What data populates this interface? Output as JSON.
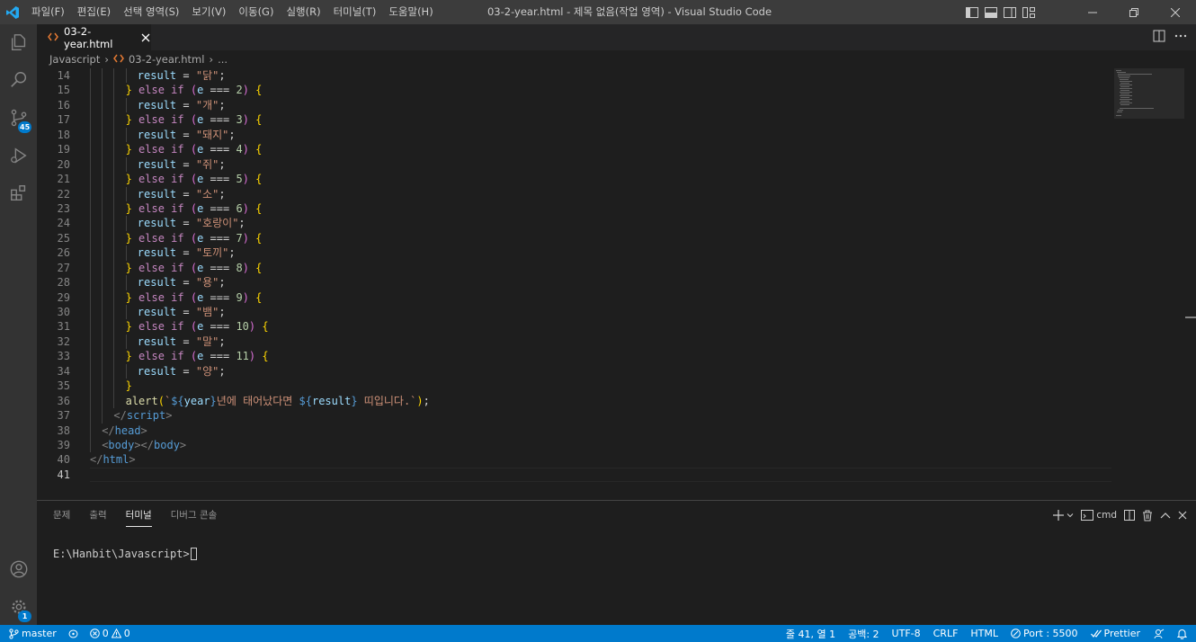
{
  "window": {
    "title": "03-2-year.html - 제목 없음(작업 영역) - Visual Studio Code",
    "menu": [
      "파일(F)",
      "편집(E)",
      "선택 영역(S)",
      "보기(V)",
      "이동(G)",
      "실행(R)",
      "터미널(T)",
      "도움말(H)"
    ]
  },
  "activity": {
    "scm_badge": "45",
    "settings_badge": "1"
  },
  "tab": {
    "label": "03-2-year.html"
  },
  "breadcrumb": {
    "folder": "Javascript",
    "file": "03-2-year.html",
    "more": "..."
  },
  "colors": {
    "accent": "#007acc",
    "keyword": "#c586c0",
    "string": "#ce9178",
    "variable": "#9cdcfe",
    "number": "#b5cea8",
    "tag": "#569cd6",
    "function": "#dcdcaa",
    "bracket_gold": "#ffd700",
    "bracket_purple": "#da70d6",
    "punct": "#808080"
  },
  "editor": {
    "current_line": 41,
    "lines": [
      {
        "n": "14",
        "indent": 4,
        "tokens": [
          {
            "t": "result",
            "c": "variable"
          },
          {
            "t": " = ",
            "c": "text"
          },
          {
            "t": "\"닭\"",
            "c": "string"
          },
          {
            "t": ";",
            "c": "text"
          }
        ]
      },
      {
        "n": "15",
        "indent": 3,
        "tokens": [
          {
            "t": "}",
            "c": "bracket_gold"
          },
          {
            "t": " else if ",
            "c": "keyword"
          },
          {
            "t": "(",
            "c": "bracket_purple"
          },
          {
            "t": "e",
            "c": "variable"
          },
          {
            "t": " === ",
            "c": "text"
          },
          {
            "t": "2",
            "c": "number"
          },
          {
            "t": ")",
            "c": "bracket_purple"
          },
          {
            "t": " ",
            "c": "text"
          },
          {
            "t": "{",
            "c": "bracket_gold"
          }
        ]
      },
      {
        "n": "16",
        "indent": 4,
        "tokens": [
          {
            "t": "result",
            "c": "variable"
          },
          {
            "t": " = ",
            "c": "text"
          },
          {
            "t": "\"개\"",
            "c": "string"
          },
          {
            "t": ";",
            "c": "text"
          }
        ]
      },
      {
        "n": "17",
        "indent": 3,
        "tokens": [
          {
            "t": "}",
            "c": "bracket_gold"
          },
          {
            "t": " else if ",
            "c": "keyword"
          },
          {
            "t": "(",
            "c": "bracket_purple"
          },
          {
            "t": "e",
            "c": "variable"
          },
          {
            "t": " === ",
            "c": "text"
          },
          {
            "t": "3",
            "c": "number"
          },
          {
            "t": ")",
            "c": "bracket_purple"
          },
          {
            "t": " ",
            "c": "text"
          },
          {
            "t": "{",
            "c": "bracket_gold"
          }
        ]
      },
      {
        "n": "18",
        "indent": 4,
        "tokens": [
          {
            "t": "result",
            "c": "variable"
          },
          {
            "t": " = ",
            "c": "text"
          },
          {
            "t": "\"돼지\"",
            "c": "string"
          },
          {
            "t": ";",
            "c": "text"
          }
        ]
      },
      {
        "n": "19",
        "indent": 3,
        "tokens": [
          {
            "t": "}",
            "c": "bracket_gold"
          },
          {
            "t": " else if ",
            "c": "keyword"
          },
          {
            "t": "(",
            "c": "bracket_purple"
          },
          {
            "t": "e",
            "c": "variable"
          },
          {
            "t": " === ",
            "c": "text"
          },
          {
            "t": "4",
            "c": "number"
          },
          {
            "t": ")",
            "c": "bracket_purple"
          },
          {
            "t": " ",
            "c": "text"
          },
          {
            "t": "{",
            "c": "bracket_gold"
          }
        ]
      },
      {
        "n": "20",
        "indent": 4,
        "tokens": [
          {
            "t": "result",
            "c": "variable"
          },
          {
            "t": " = ",
            "c": "text"
          },
          {
            "t": "\"쥐\"",
            "c": "string"
          },
          {
            "t": ";",
            "c": "text"
          }
        ]
      },
      {
        "n": "21",
        "indent": 3,
        "tokens": [
          {
            "t": "}",
            "c": "bracket_gold"
          },
          {
            "t": " else if ",
            "c": "keyword"
          },
          {
            "t": "(",
            "c": "bracket_purple"
          },
          {
            "t": "e",
            "c": "variable"
          },
          {
            "t": " === ",
            "c": "text"
          },
          {
            "t": "5",
            "c": "number"
          },
          {
            "t": ")",
            "c": "bracket_purple"
          },
          {
            "t": " ",
            "c": "text"
          },
          {
            "t": "{",
            "c": "bracket_gold"
          }
        ]
      },
      {
        "n": "22",
        "indent": 4,
        "tokens": [
          {
            "t": "result",
            "c": "variable"
          },
          {
            "t": " = ",
            "c": "text"
          },
          {
            "t": "\"소\"",
            "c": "string"
          },
          {
            "t": ";",
            "c": "text"
          }
        ]
      },
      {
        "n": "23",
        "indent": 3,
        "tokens": [
          {
            "t": "}",
            "c": "bracket_gold"
          },
          {
            "t": " else if ",
            "c": "keyword"
          },
          {
            "t": "(",
            "c": "bracket_purple"
          },
          {
            "t": "e",
            "c": "variable"
          },
          {
            "t": " === ",
            "c": "text"
          },
          {
            "t": "6",
            "c": "number"
          },
          {
            "t": ")",
            "c": "bracket_purple"
          },
          {
            "t": " ",
            "c": "text"
          },
          {
            "t": "{",
            "c": "bracket_gold"
          }
        ]
      },
      {
        "n": "24",
        "indent": 4,
        "tokens": [
          {
            "t": "result",
            "c": "variable"
          },
          {
            "t": " = ",
            "c": "text"
          },
          {
            "t": "\"호랑이\"",
            "c": "string"
          },
          {
            "t": ";",
            "c": "text"
          }
        ]
      },
      {
        "n": "25",
        "indent": 3,
        "tokens": [
          {
            "t": "}",
            "c": "bracket_gold"
          },
          {
            "t": " else if ",
            "c": "keyword"
          },
          {
            "t": "(",
            "c": "bracket_purple"
          },
          {
            "t": "e",
            "c": "variable"
          },
          {
            "t": " === ",
            "c": "text"
          },
          {
            "t": "7",
            "c": "number"
          },
          {
            "t": ")",
            "c": "bracket_purple"
          },
          {
            "t": " ",
            "c": "text"
          },
          {
            "t": "{",
            "c": "bracket_gold"
          }
        ]
      },
      {
        "n": "26",
        "indent": 4,
        "tokens": [
          {
            "t": "result",
            "c": "variable"
          },
          {
            "t": " = ",
            "c": "text"
          },
          {
            "t": "\"토끼\"",
            "c": "string"
          },
          {
            "t": ";",
            "c": "text"
          }
        ]
      },
      {
        "n": "27",
        "indent": 3,
        "tokens": [
          {
            "t": "}",
            "c": "bracket_gold"
          },
          {
            "t": " else if ",
            "c": "keyword"
          },
          {
            "t": "(",
            "c": "bracket_purple"
          },
          {
            "t": "e",
            "c": "variable"
          },
          {
            "t": " === ",
            "c": "text"
          },
          {
            "t": "8",
            "c": "number"
          },
          {
            "t": ")",
            "c": "bracket_purple"
          },
          {
            "t": " ",
            "c": "text"
          },
          {
            "t": "{",
            "c": "bracket_gold"
          }
        ]
      },
      {
        "n": "28",
        "indent": 4,
        "tokens": [
          {
            "t": "result",
            "c": "variable"
          },
          {
            "t": " = ",
            "c": "text"
          },
          {
            "t": "\"용\"",
            "c": "string"
          },
          {
            "t": ";",
            "c": "text"
          }
        ]
      },
      {
        "n": "29",
        "indent": 3,
        "tokens": [
          {
            "t": "}",
            "c": "bracket_gold"
          },
          {
            "t": " else if ",
            "c": "keyword"
          },
          {
            "t": "(",
            "c": "bracket_purple"
          },
          {
            "t": "e",
            "c": "variable"
          },
          {
            "t": " === ",
            "c": "text"
          },
          {
            "t": "9",
            "c": "number"
          },
          {
            "t": ")",
            "c": "bracket_purple"
          },
          {
            "t": " ",
            "c": "text"
          },
          {
            "t": "{",
            "c": "bracket_gold"
          }
        ]
      },
      {
        "n": "30",
        "indent": 4,
        "tokens": [
          {
            "t": "result",
            "c": "variable"
          },
          {
            "t": " = ",
            "c": "text"
          },
          {
            "t": "\"뱀\"",
            "c": "string"
          },
          {
            "t": ";",
            "c": "text"
          }
        ]
      },
      {
        "n": "31",
        "indent": 3,
        "tokens": [
          {
            "t": "}",
            "c": "bracket_gold"
          },
          {
            "t": " else if ",
            "c": "keyword"
          },
          {
            "t": "(",
            "c": "bracket_purple"
          },
          {
            "t": "e",
            "c": "variable"
          },
          {
            "t": " === ",
            "c": "text"
          },
          {
            "t": "10",
            "c": "number"
          },
          {
            "t": ")",
            "c": "bracket_purple"
          },
          {
            "t": " ",
            "c": "text"
          },
          {
            "t": "{",
            "c": "bracket_gold"
          }
        ]
      },
      {
        "n": "32",
        "indent": 4,
        "tokens": [
          {
            "t": "result",
            "c": "variable"
          },
          {
            "t": " = ",
            "c": "text"
          },
          {
            "t": "\"말\"",
            "c": "string"
          },
          {
            "t": ";",
            "c": "text"
          }
        ]
      },
      {
        "n": "33",
        "indent": 3,
        "tokens": [
          {
            "t": "}",
            "c": "bracket_gold"
          },
          {
            "t": " else if ",
            "c": "keyword"
          },
          {
            "t": "(",
            "c": "bracket_purple"
          },
          {
            "t": "e",
            "c": "variable"
          },
          {
            "t": " === ",
            "c": "text"
          },
          {
            "t": "11",
            "c": "number"
          },
          {
            "t": ")",
            "c": "bracket_purple"
          },
          {
            "t": " ",
            "c": "text"
          },
          {
            "t": "{",
            "c": "bracket_gold"
          }
        ]
      },
      {
        "n": "34",
        "indent": 4,
        "tokens": [
          {
            "t": "result",
            "c": "variable"
          },
          {
            "t": " = ",
            "c": "text"
          },
          {
            "t": "\"양\"",
            "c": "string"
          },
          {
            "t": ";",
            "c": "text"
          }
        ]
      },
      {
        "n": "35",
        "indent": 3,
        "tokens": [
          {
            "t": "}",
            "c": "bracket_gold"
          }
        ]
      },
      {
        "n": "36",
        "indent": 3,
        "tokens": [
          {
            "t": "alert",
            "c": "function"
          },
          {
            "t": "(",
            "c": "bracket_gold"
          },
          {
            "t": "`",
            "c": "string"
          },
          {
            "t": "${",
            "c": "tag"
          },
          {
            "t": "year",
            "c": "variable"
          },
          {
            "t": "}",
            "c": "tag"
          },
          {
            "t": "년에 태어났다면 ",
            "c": "string"
          },
          {
            "t": "${",
            "c": "tag"
          },
          {
            "t": "result",
            "c": "variable"
          },
          {
            "t": "}",
            "c": "tag"
          },
          {
            "t": " 띠입니다.`",
            "c": "string"
          },
          {
            "t": ")",
            "c": "bracket_gold"
          },
          {
            "t": ";",
            "c": "text"
          }
        ]
      },
      {
        "n": "37",
        "indent": 2,
        "tokens": [
          {
            "t": "</",
            "c": "punct"
          },
          {
            "t": "script",
            "c": "tag"
          },
          {
            "t": ">",
            "c": "punct"
          }
        ]
      },
      {
        "n": "38",
        "indent": 1,
        "tokens": [
          {
            "t": "</",
            "c": "punct"
          },
          {
            "t": "head",
            "c": "tag"
          },
          {
            "t": ">",
            "c": "punct"
          }
        ]
      },
      {
        "n": "39",
        "indent": 1,
        "tokens": [
          {
            "t": "<",
            "c": "punct"
          },
          {
            "t": "body",
            "c": "tag"
          },
          {
            "t": "></",
            "c": "punct"
          },
          {
            "t": "body",
            "c": "tag"
          },
          {
            "t": ">",
            "c": "punct"
          }
        ]
      },
      {
        "n": "40",
        "indent": 0,
        "tokens": [
          {
            "t": "</",
            "c": "punct"
          },
          {
            "t": "html",
            "c": "tag"
          },
          {
            "t": ">",
            "c": "punct"
          }
        ]
      },
      {
        "n": "41",
        "indent": 0,
        "tokens": []
      }
    ]
  },
  "panel": {
    "tabs": [
      "문제",
      "출력",
      "터미널",
      "디버그 콘솔"
    ],
    "active_tab": 2,
    "terminal_profile": "cmd",
    "terminal_prompt": "E:\\Hanbit\\Javascript>"
  },
  "status": {
    "branch": "master",
    "errors": "0",
    "warnings": "0",
    "position": "줄 41, 열 1",
    "spaces": "공백: 2",
    "encoding": "UTF-8",
    "eol": "CRLF",
    "language": "HTML",
    "port": "Port : 5500",
    "prettier": "Prettier"
  }
}
